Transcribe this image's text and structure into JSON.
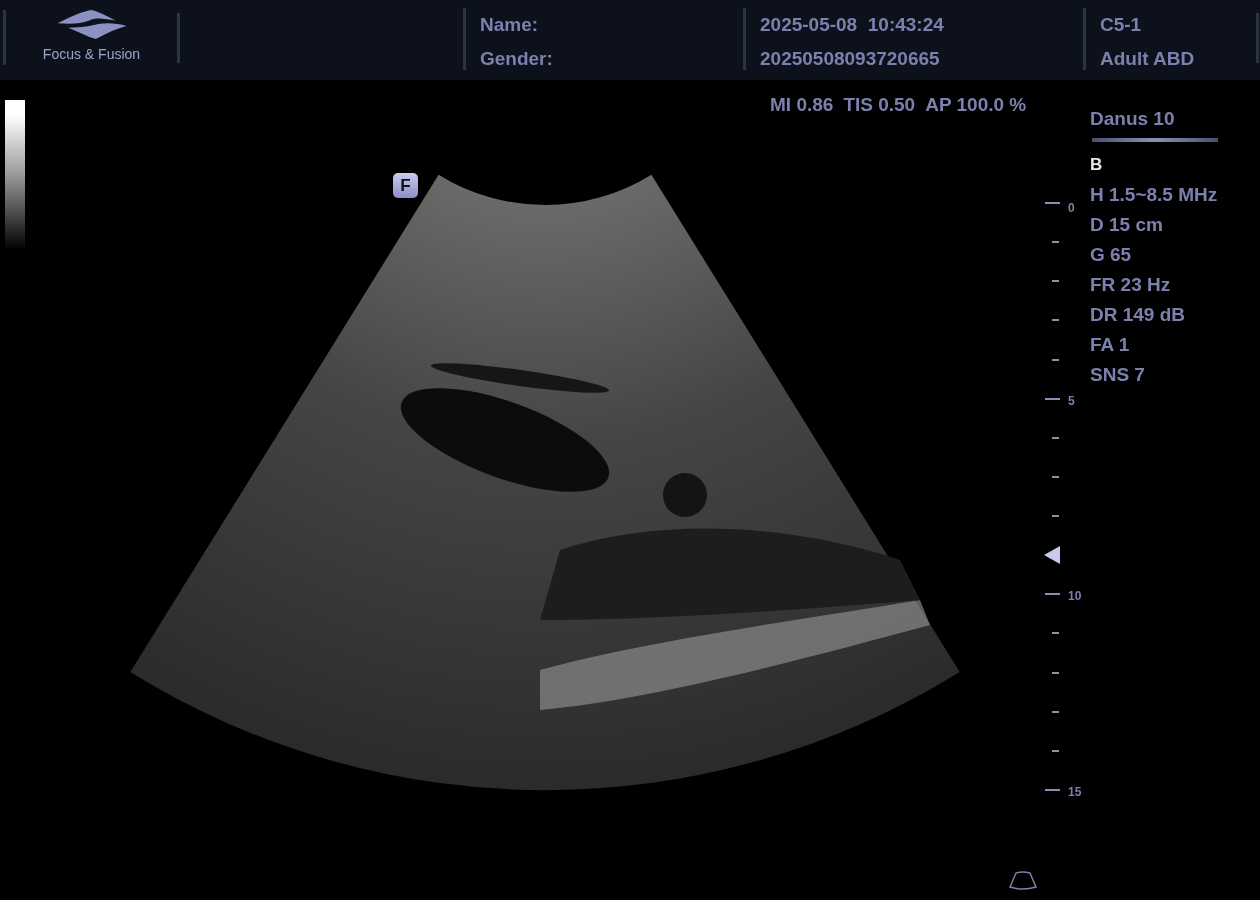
{
  "header": {
    "logo_text": "Focus & Fusion",
    "patient": {
      "name_label": "Name:",
      "gender_label": "Gender:"
    },
    "exam": {
      "datetime": "2025-05-08  10:43:24",
      "exam_id": "20250508093720665"
    },
    "probe": {
      "model": "C5-1",
      "preset": "Adult ABD"
    }
  },
  "acoustic_output": [
    "MI 0.86",
    "TIS 0.50",
    "AP 100.0 %"
  ],
  "focus_badge": "F",
  "depth_scale": {
    "ticks": [
      {
        "kind": "major",
        "label": "0",
        "focus": false
      },
      {
        "kind": "minor",
        "focus": false
      },
      {
        "kind": "minor",
        "focus": false
      },
      {
        "kind": "minor",
        "focus": false
      },
      {
        "kind": "minor",
        "focus": false
      },
      {
        "kind": "major",
        "label": "5",
        "focus": false
      },
      {
        "kind": "minor",
        "focus": false
      },
      {
        "kind": "minor",
        "focus": false
      },
      {
        "kind": "minor",
        "focus": false
      },
      {
        "kind": "minor",
        "focus": true
      },
      {
        "kind": "major",
        "label": "10",
        "focus": false
      },
      {
        "kind": "minor",
        "focus": false
      },
      {
        "kind": "minor",
        "focus": false
      },
      {
        "kind": "minor",
        "focus": false
      },
      {
        "kind": "minor",
        "focus": false
      },
      {
        "kind": "major",
        "label": "15",
        "focus": false
      }
    ]
  },
  "system_name": "Danus 10",
  "mode": "B",
  "parameters": [
    "H 1.5~8.5 MHz",
    "D 15 cm",
    "G 65",
    "FR 23 Hz",
    "DR 149 dB",
    "FA 1",
    "SNS 7"
  ]
}
